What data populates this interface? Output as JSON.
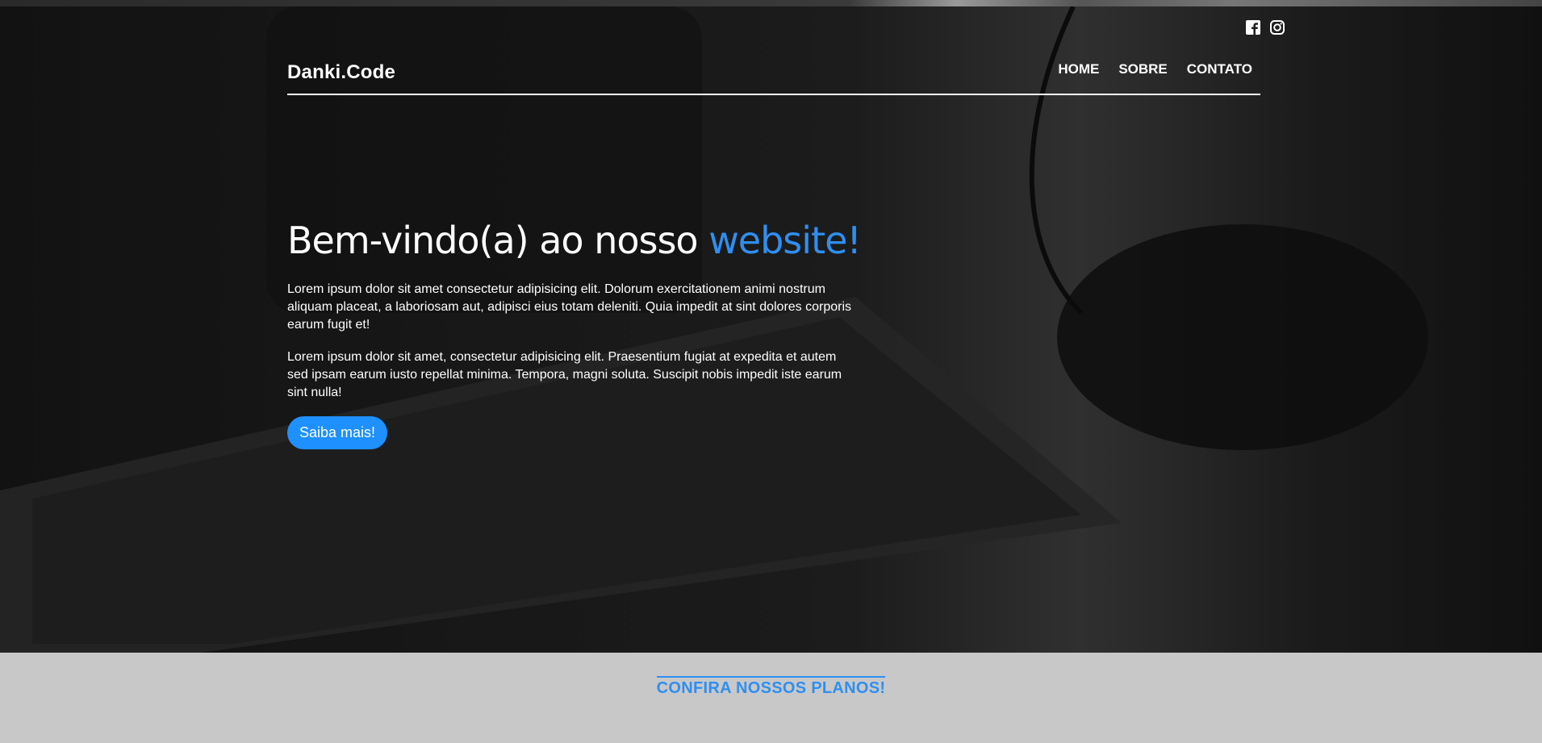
{
  "brand": {
    "logo": "Danki.Code"
  },
  "social": {
    "icons": [
      "facebook-icon",
      "instagram-icon"
    ]
  },
  "nav": {
    "items": [
      "HOME",
      "SOBRE",
      "CONTATO"
    ]
  },
  "hero": {
    "title_main": "Bem-vindo(a) ao nosso ",
    "title_accent": "website!",
    "paragraphs": [
      "Lorem ipsum dolor sit amet consectetur adipisicing elit. Dolorum exercitationem animi nostrum aliquam placeat, a laboriosam aut, adipisci eius totam deleniti. Quia impedit at sint dolores corporis earum fugit et!",
      "Lorem ipsum dolor sit amet, consectetur adipisicing elit. Praesentium fugiat at expedita et autem sed ipsam earum iusto repellat minima. Tempora, magni soluta. Suscipit nobis impedit iste earum sint nulla!"
    ],
    "button_label": "Saiba mais!"
  },
  "plans": {
    "title": "CONFIRA NOSSOS PLANOS!"
  },
  "colors": {
    "accent": "#2f8ff0",
    "button": "#1e90ff",
    "section_bg": "#c8c8c8"
  }
}
